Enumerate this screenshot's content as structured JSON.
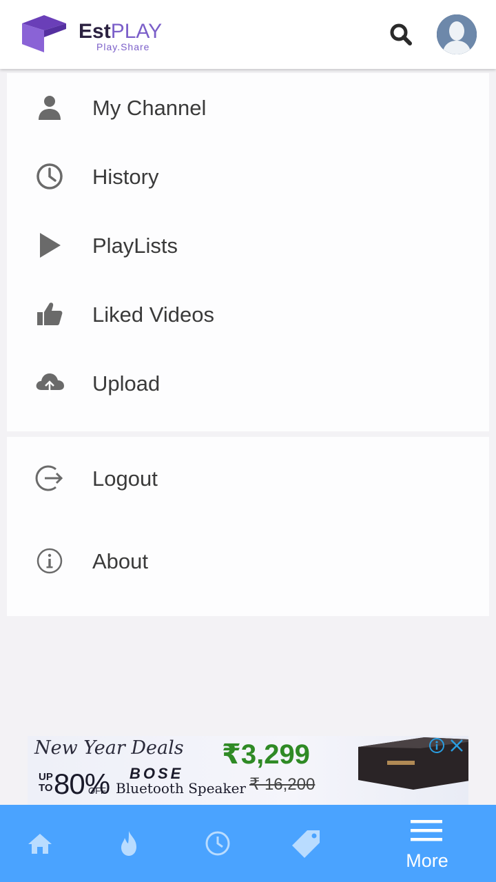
{
  "header": {
    "logo": {
      "brand_bold": "Est",
      "brand_light": "PLAY",
      "tagline": "Play.Share"
    },
    "search_icon": "search-icon",
    "avatar_icon": "user-avatar"
  },
  "menu": {
    "primary": [
      {
        "label": "My Channel",
        "icon": "person-icon"
      },
      {
        "label": "History",
        "icon": "clock-icon"
      },
      {
        "label": "PlayLists",
        "icon": "play-icon"
      },
      {
        "label": "Liked Videos",
        "icon": "thumbs-up-icon"
      },
      {
        "label": "Upload",
        "icon": "cloud-upload-icon"
      }
    ],
    "secondary": [
      {
        "label": "Logout",
        "icon": "logout-icon"
      },
      {
        "label": "About",
        "icon": "info-icon"
      }
    ]
  },
  "ad": {
    "headline": "New Year Deals",
    "upto": "UP TO",
    "discount": "80%",
    "off": "OFF",
    "brand": "BOSE",
    "product": "Bluetooth Speaker",
    "price": "₹3,299",
    "old_price": "₹ 16,200"
  },
  "bottom_nav": {
    "items": [
      {
        "icon": "home-icon"
      },
      {
        "icon": "trending-icon"
      },
      {
        "icon": "history-icon"
      },
      {
        "icon": "tag-icon"
      }
    ],
    "more_label": "More"
  },
  "colors": {
    "accent": "#4aa3ff",
    "brand_purple": "#7b5fc9",
    "icon_gray": "#6a6a6a",
    "price_green": "#2f8a25"
  }
}
